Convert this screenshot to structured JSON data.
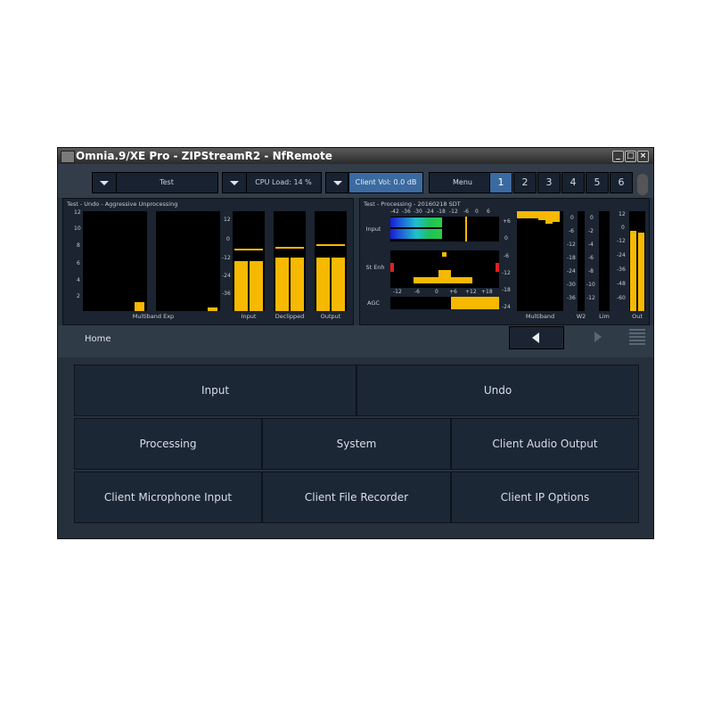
{
  "window": {
    "title": "Omnia.9/XE Pro - ZIPStreamR2 - NfRemote",
    "minimize": "_",
    "maximize": "□",
    "close": "×"
  },
  "toolbar": {
    "preset": "Test",
    "cpu": "CPU Load: 14 %",
    "client_vol": "Client Vol: 0.0 dB",
    "menu": "Menu",
    "pages": [
      "1",
      "2",
      "3",
      "4",
      "5",
      "6"
    ],
    "active_page": "1"
  },
  "left_panel": {
    "title": "Test - Undo - Aggressive Unprocessing",
    "scale1": [
      "12",
      "10",
      "8",
      "6",
      "4",
      "2"
    ],
    "scale2": [
      "12",
      "0",
      "-12",
      "-24",
      "-36"
    ],
    "labels": {
      "multiband_exp": "Multiband Exp",
      "input": "Input",
      "declipped": "Declipped",
      "output": "Output"
    }
  },
  "right_panel": {
    "title": "Test - Processing - 20160218 SDT",
    "top_scale": [
      "-42",
      "-36",
      "-30",
      "-24",
      "-18",
      "-12",
      "-6",
      "0",
      "6"
    ],
    "left_scale": [
      "+6",
      "0",
      "-6",
      "-12",
      "-18",
      "-24"
    ],
    "bottom_scale": [
      "-12",
      "-6",
      "0",
      "+6",
      "+12",
      "+18"
    ],
    "rows": {
      "input": "Input",
      "st_enh": "St Enh",
      "agc": "AGC"
    },
    "w2_scale": [
      "0",
      "-6",
      "-12",
      "-18",
      "-24",
      "-30",
      "-36"
    ],
    "lim_scale": [
      "0",
      "-2",
      "-4",
      "-6",
      "-8",
      "-10",
      "-12"
    ],
    "out_scale": [
      "12",
      "0",
      "-12",
      "-24",
      "-36",
      "-48",
      "-60"
    ],
    "labels": {
      "multiband": "Multiband",
      "w2": "W2",
      "lim": "Lim",
      "out": "Out"
    }
  },
  "meter_levels": {
    "input_l": 0.8,
    "input_r": 0.8,
    "declipped_l": 0.8,
    "declipped_r": 0.8,
    "output_l": 0.8,
    "output_r": 0.8,
    "out_l": 0.8,
    "out_r": 0.78,
    "agc": 0.45
  },
  "nav": {
    "breadcrumb": "Home"
  },
  "tiles": {
    "input": "Input",
    "undo": "Undo",
    "processing": "Processing",
    "system": "System",
    "client_audio_output": "Client Audio Output",
    "client_microphone_input": "Client Microphone Input",
    "client_file_recorder": "Client File Recorder",
    "client_ip_options": "Client IP Options"
  },
  "colors": {
    "meter": "#f6b900",
    "active_page": "#3b6aa0",
    "background": "#2b3542"
  }
}
